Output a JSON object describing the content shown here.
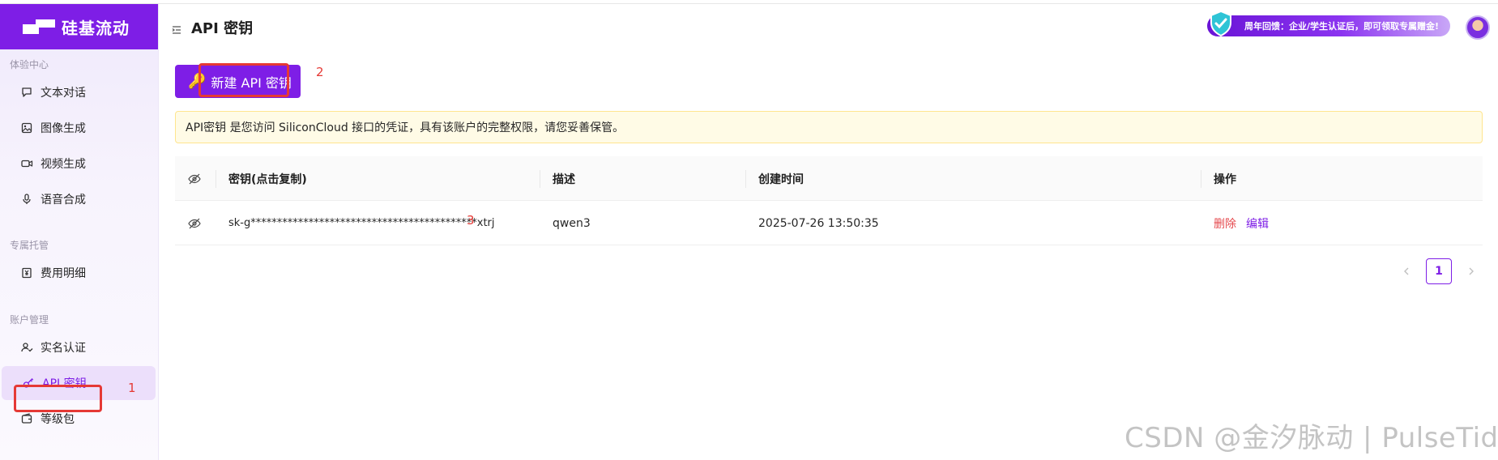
{
  "app": {
    "brand": "硅基流动"
  },
  "header": {
    "title": "API 密钥",
    "promo_text": "周年回馈：企业/学生认证后，即可领取专属赠金!"
  },
  "sidebar": {
    "groups": [
      {
        "label": "体验中心"
      },
      {
        "label": "专属托管"
      },
      {
        "label": "账户管理"
      }
    ],
    "items": [
      {
        "label": "文本对话",
        "icon": "chat-icon"
      },
      {
        "label": "图像生成",
        "icon": "image-icon"
      },
      {
        "label": "视频生成",
        "icon": "video-icon"
      },
      {
        "label": "语音合成",
        "icon": "microphone-icon"
      },
      {
        "label": "费用明细",
        "icon": "yen-icon"
      },
      {
        "label": "实名认证",
        "icon": "user-check-icon"
      },
      {
        "label": "API 密钥",
        "icon": "key-icon",
        "active": true
      },
      {
        "label": "等级包",
        "icon": "wallet-icon"
      }
    ]
  },
  "main": {
    "new_button_label": "新建 API 密钥",
    "alert_text": "API密钥 是您访问 SiliconCloud 接口的凭证，具有该账户的完整权限，请您妥善保管。",
    "table": {
      "columns": [
        "密钥(点击复制)",
        "描述",
        "创建时间",
        "操作"
      ],
      "rows": [
        {
          "key": "sk-g*******************************************xtrj",
          "description": "qwen3",
          "created": "2025-07-26 13:50:35",
          "actions": [
            "删除",
            "编辑"
          ]
        }
      ]
    },
    "pagination": {
      "current": "1"
    }
  },
  "annotations": [
    "1",
    "2",
    "3"
  ],
  "watermark": "CSDN @金汐脉动 | PulseTide",
  "colors": {
    "brand": "#7e1ee6",
    "danger": "#e5484d",
    "highlight": "#e53935",
    "alert_bg": "#fffbe6"
  }
}
